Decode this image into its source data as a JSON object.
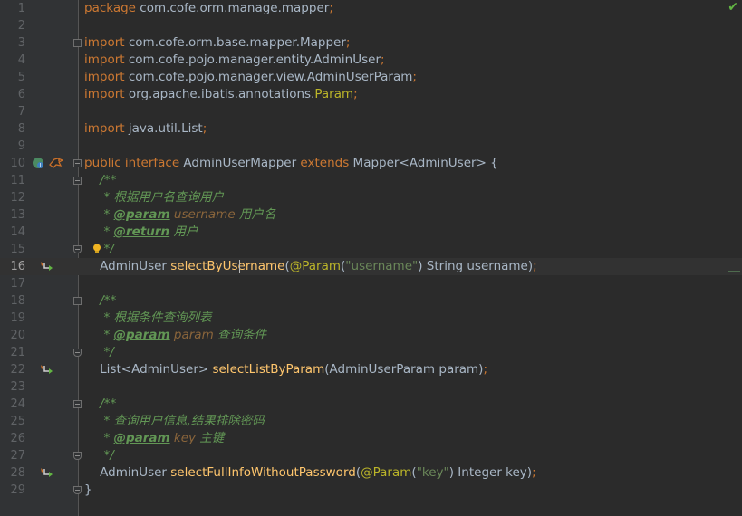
{
  "status": {
    "check_icon": "check-icon",
    "color": "#62b543"
  },
  "colors": {
    "background": "#2b2b2b",
    "gutter": "#313335",
    "keyword": "#cc7832",
    "method": "#ffc66d",
    "comment": "#629755",
    "annotation": "#bbb529",
    "string": "#6a8759",
    "text": "#a9b7c6"
  },
  "lines": [
    {
      "n": "1",
      "t": [
        {
          "k": "kw",
          "v": "package"
        },
        {
          "k": "",
          "v": " com.cofe.orm.manage.mapper"
        },
        {
          "k": "kw",
          "v": ";"
        }
      ]
    },
    {
      "n": "2",
      "t": []
    },
    {
      "n": "3",
      "t": [
        {
          "k": "kw",
          "v": "import"
        },
        {
          "k": "",
          "v": " com.cofe.orm.base.mapper.Mapper"
        },
        {
          "k": "kw",
          "v": ";"
        }
      ]
    },
    {
      "n": "4",
      "t": [
        {
          "k": "kw",
          "v": "import"
        },
        {
          "k": "",
          "v": " com.cofe.pojo.manager.entity.AdminUser"
        },
        {
          "k": "kw",
          "v": ";"
        }
      ]
    },
    {
      "n": "5",
      "t": [
        {
          "k": "kw",
          "v": "import"
        },
        {
          "k": "",
          "v": " com.cofe.pojo.manager.view.AdminUserParam"
        },
        {
          "k": "kw",
          "v": ";"
        }
      ]
    },
    {
      "n": "6",
      "t": [
        {
          "k": "kw",
          "v": "import"
        },
        {
          "k": "",
          "v": " org.apache.ibatis.annotations."
        },
        {
          "k": "an",
          "v": "Param"
        },
        {
          "k": "kw",
          "v": ";"
        }
      ]
    },
    {
      "n": "7",
      "t": []
    },
    {
      "n": "8",
      "t": [
        {
          "k": "kw",
          "v": "import"
        },
        {
          "k": "",
          "v": " java.util.List"
        },
        {
          "k": "kw",
          "v": ";"
        }
      ]
    },
    {
      "n": "9",
      "t": []
    },
    {
      "n": "10",
      "t": [
        {
          "k": "kw",
          "v": "public interface"
        },
        {
          "k": "",
          "v": " AdminUserMapper "
        },
        {
          "k": "kw",
          "v": "extends"
        },
        {
          "k": "",
          "v": " Mapper<AdminUser> {"
        }
      ]
    },
    {
      "n": "11",
      "t": [
        {
          "k": "cm",
          "v": "    /**"
        }
      ]
    },
    {
      "n": "12",
      "t": [
        {
          "k": "cm",
          "v": "     * 根据用户名查询用户"
        }
      ]
    },
    {
      "n": "13",
      "t": [
        {
          "k": "cm",
          "v": "     * "
        },
        {
          "k": "tag",
          "v": "@param"
        },
        {
          "k": "pn",
          "v": " username"
        },
        {
          "k": "cm",
          "v": " 用户名"
        }
      ]
    },
    {
      "n": "14",
      "t": [
        {
          "k": "cm",
          "v": "     * "
        },
        {
          "k": "tag",
          "v": "@return"
        },
        {
          "k": "cm",
          "v": " 用户"
        }
      ]
    },
    {
      "n": "15",
      "t": [
        {
          "k": "cm",
          "v": "     */"
        }
      ]
    },
    {
      "n": "16",
      "t": [
        {
          "k": "",
          "v": "    AdminUser "
        },
        {
          "k": "fn",
          "v": "selectByUsername"
        },
        {
          "k": "",
          "v": "("
        },
        {
          "k": "an",
          "v": "@Param"
        },
        {
          "k": "",
          "v": "("
        },
        {
          "k": "st",
          "v": "\"username\""
        },
        {
          "k": "",
          "v": ") String username)"
        },
        {
          "k": "kw",
          "v": ";"
        }
      ]
    },
    {
      "n": "17",
      "t": []
    },
    {
      "n": "18",
      "t": [
        {
          "k": "cm",
          "v": "    /**"
        }
      ]
    },
    {
      "n": "19",
      "t": [
        {
          "k": "cm",
          "v": "     * 根据条件查询列表"
        }
      ]
    },
    {
      "n": "20",
      "t": [
        {
          "k": "cm",
          "v": "     * "
        },
        {
          "k": "tag",
          "v": "@param"
        },
        {
          "k": "pn",
          "v": " param"
        },
        {
          "k": "cm",
          "v": " 查询条件"
        }
      ]
    },
    {
      "n": "21",
      "t": [
        {
          "k": "cm",
          "v": "     */"
        }
      ]
    },
    {
      "n": "22",
      "t": [
        {
          "k": "",
          "v": "    List<AdminUser> "
        },
        {
          "k": "fn",
          "v": "selectListByParam"
        },
        {
          "k": "",
          "v": "(AdminUserParam param)"
        },
        {
          "k": "kw",
          "v": ";"
        }
      ]
    },
    {
      "n": "23",
      "t": []
    },
    {
      "n": "24",
      "t": [
        {
          "k": "cm",
          "v": "    /**"
        }
      ]
    },
    {
      "n": "25",
      "t": [
        {
          "k": "cm",
          "v": "     * 查询用户信息,结果排除密码"
        }
      ]
    },
    {
      "n": "26",
      "t": [
        {
          "k": "cm",
          "v": "     * "
        },
        {
          "k": "tag",
          "v": "@param"
        },
        {
          "k": "pn",
          "v": " key"
        },
        {
          "k": "cm",
          "v": " 主键"
        }
      ]
    },
    {
      "n": "27",
      "t": [
        {
          "k": "cm",
          "v": "     */"
        }
      ]
    },
    {
      "n": "28",
      "t": [
        {
          "k": "",
          "v": "    AdminUser "
        },
        {
          "k": "fn",
          "v": "selectFullInfoWithoutPassword"
        },
        {
          "k": "",
          "v": "("
        },
        {
          "k": "an",
          "v": "@Param"
        },
        {
          "k": "",
          "v": "("
        },
        {
          "k": "st",
          "v": "\"key\""
        },
        {
          "k": "",
          "v": ") Integer key)"
        },
        {
          "k": "kw",
          "v": ";"
        }
      ]
    },
    {
      "n": "29",
      "t": [
        {
          "k": "",
          "v": "}"
        }
      ]
    }
  ],
  "current_line": "16",
  "fold_markers": {
    "open": [
      "3",
      "10",
      "11",
      "18",
      "24"
    ],
    "end": [
      "15",
      "21",
      "27",
      "29"
    ]
  },
  "gutter_icons": {
    "10": [
      "implemented-interface-icon",
      "mybatis-bird-icon"
    ],
    "16": [
      "mapper-navigate-arrow-icon"
    ],
    "22": [
      "mapper-navigate-arrow-icon"
    ],
    "28": [
      "mapper-navigate-arrow-icon"
    ],
    "15": [
      "intention-bulb-icon"
    ]
  }
}
